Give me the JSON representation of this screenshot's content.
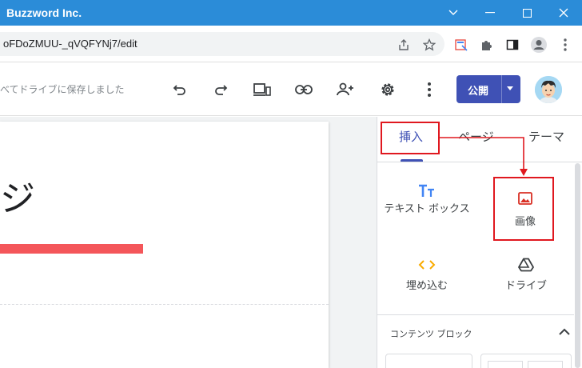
{
  "window": {
    "title": "Buzzword Inc.",
    "title_color": "#2b8cd8"
  },
  "browser": {
    "url": "oFDoZMUU-_qVQFYNj7/edit",
    "icons": [
      "share-icon",
      "star-icon",
      "extension-page-icon",
      "puzzle-icon",
      "sidepanel-icon",
      "profile-icon",
      "more-vert-icon"
    ]
  },
  "toolbar": {
    "save_status": "べてドライブに保存しました",
    "icons": [
      "undo-icon",
      "redo-icon",
      "preview-icon",
      "link-icon",
      "share-user-icon",
      "settings-icon",
      "more-icon"
    ],
    "publish_label": "公開",
    "accent": "#3f51b5"
  },
  "canvas": {
    "heading_fragment": "ジ",
    "bar_color": "#f4565a"
  },
  "panel": {
    "tabs": [
      {
        "label": "挿入",
        "active": true
      },
      {
        "label": "ページ",
        "active": false
      },
      {
        "label": "テーマ",
        "active": false
      }
    ],
    "items": [
      {
        "label": "テキスト ボックス",
        "icon": "text-box-icon"
      },
      {
        "label": "画像",
        "icon": "image-icon"
      },
      {
        "label": "埋め込む",
        "icon": "embed-code-icon"
      },
      {
        "label": "ドライブ",
        "icon": "drive-icon"
      }
    ],
    "section_title": "コンテンツ ブロック",
    "highlight_color": "#e0181f"
  }
}
